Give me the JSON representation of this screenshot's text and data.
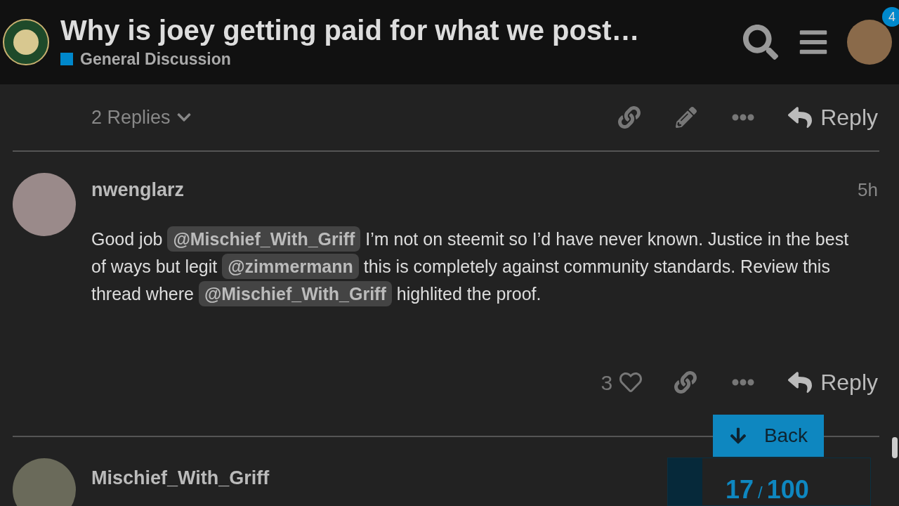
{
  "header": {
    "title": "Why is joey getting paid for what we post…",
    "category": {
      "name": "General Discussion",
      "color": "#0088cc"
    },
    "notification_count": "4"
  },
  "previous_post_actions": {
    "replies": "2 Replies",
    "reply": "Reply"
  },
  "post": {
    "author": "nwenglarz",
    "time": "5h",
    "body": [
      {
        "kind": "text",
        "text": "Good job "
      },
      {
        "kind": "mention",
        "text": "@Mischief_With_Griff"
      },
      {
        "kind": "text",
        "text": " I’m not on steemit so I’d have never known. Justice in the best of ways but legit "
      },
      {
        "kind": "mention",
        "text": "@zimmermann"
      },
      {
        "kind": "text",
        "text": " this is completely against community standards. Review this thread where "
      },
      {
        "kind": "mention",
        "text": "@Mischief_With_Griff"
      },
      {
        "kind": "text",
        "text": " highlited the proof."
      }
    ],
    "likes": "3",
    "reply": "Reply"
  },
  "next_post": {
    "author": "Mischief_With_Griff"
  },
  "back_button": "Back",
  "timeline": {
    "current": "17",
    "separator": "/",
    "total": "100",
    "level": 0.17
  }
}
